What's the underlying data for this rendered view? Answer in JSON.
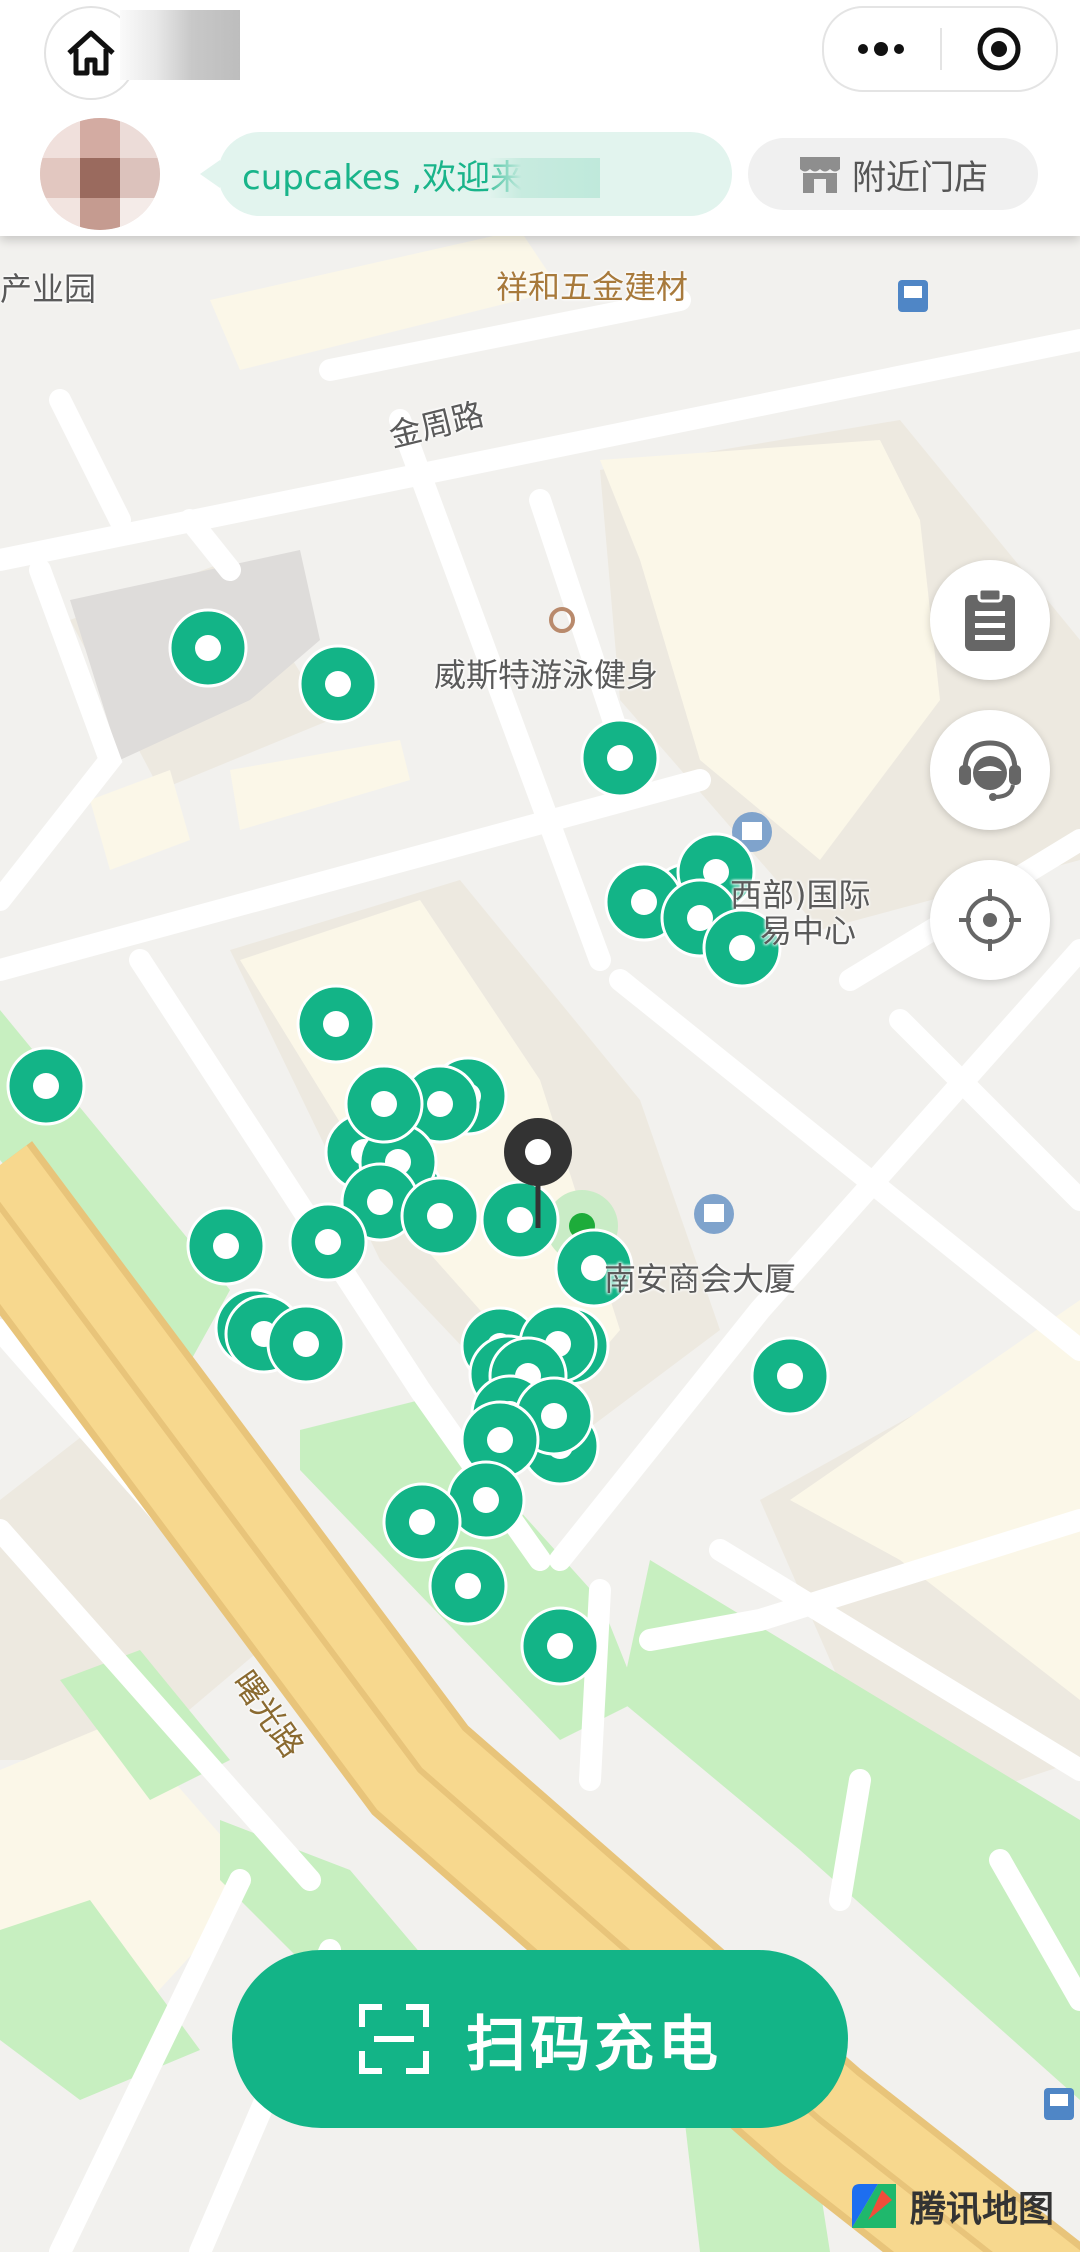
{
  "header": {
    "home_icon": "home-icon",
    "capsule": {
      "more_icon": "more-dots-icon",
      "close_icon": "target-circle-icon"
    },
    "welcome_text": "cupcakes ,欢迎来",
    "nearby_label": "附近门店",
    "nearby_icon": "store-icon"
  },
  "map": {
    "labels": {
      "industrial_park": "产业园",
      "building_materials": "祥和五金建材",
      "jinzhou_road": "金周路",
      "swimming_gym": "威斯特游泳健身",
      "intl_center_line1": "西部)国际",
      "intl_center_line2": "易中心",
      "nanan_building": "南安商会大厦",
      "shuguang_road": "曙光路"
    },
    "station_icon": "charging-station-pin",
    "user_location_icon": "location-pin-icon"
  },
  "side_buttons": [
    "clipboard-icon",
    "customer-service-icon",
    "locate-icon"
  ],
  "scan_button": {
    "label": "扫码充电",
    "icon": "scan-icon"
  },
  "attribution": {
    "label": "腾讯地图",
    "icon": "tencent-map-logo-icon"
  },
  "colors": {
    "accent": "#13b487",
    "map_bg": "#f2f1ee",
    "road_main": "#f7d88e",
    "park": "#c7efc0"
  }
}
